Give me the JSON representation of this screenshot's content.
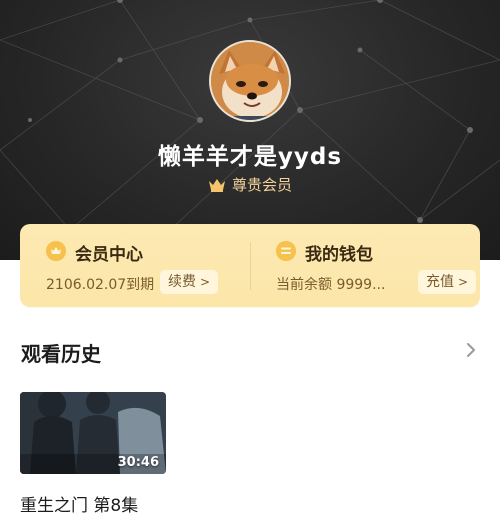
{
  "profile": {
    "username": "懒羊羊才是yyds",
    "vip_label": "尊贵会员"
  },
  "cards": {
    "member": {
      "title": "会员中心",
      "expiry": "2106.02.07到期",
      "action": "续费"
    },
    "wallet": {
      "title": "我的钱包",
      "balance": "当前余额 9999...",
      "action": "充值"
    }
  },
  "history": {
    "title": "观看历史",
    "items": [
      {
        "title": "重生之门 第8集",
        "duration": "30:46"
      }
    ]
  },
  "colors": {
    "header_bg": "#262626",
    "vip_gold": "#f3d39a",
    "card_bg": "#fce6a8",
    "card_icon": "#f6c24d"
  },
  "icons": {
    "crown": "crown-icon",
    "member": "crown-coin-icon",
    "wallet": "wallet-coin-icon",
    "more": "chevron-right-icon"
  }
}
